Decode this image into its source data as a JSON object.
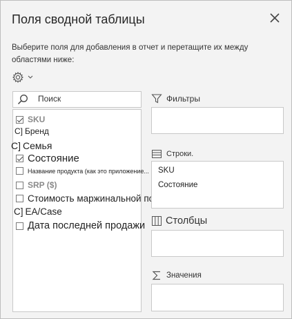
{
  "panel": {
    "title": "Поля сводной таблицы",
    "instruction": "Выберите поля для добавления в отчет и перетащите их между областями ниже:"
  },
  "icons": {
    "close": "close-icon",
    "settings": "gear-icon",
    "search": "search-icon",
    "filter": "filter-icon",
    "rows": "rows-icon",
    "columns": "columns-icon",
    "values": "sigma-icon"
  },
  "search": {
    "placeholder": "Поиск"
  },
  "fields": [
    {
      "label": "SKU",
      "checked": true,
      "style": "bold-muted",
      "prefix": ""
    },
    {
      "label": "Бренд",
      "checked": false,
      "style": "small",
      "prefix": "C]"
    },
    {
      "label": "Семья",
      "checked": false,
      "style": "medium",
      "prefix": "C]"
    },
    {
      "label": "Состояние",
      "checked": true,
      "style": "large",
      "prefix": ""
    },
    {
      "label": "Название продукта (как это приложение...",
      "checked": false,
      "style": "tiny",
      "prefix": ""
    },
    {
      "label": "SRP ($)",
      "checked": false,
      "style": "bold-muted",
      "prefix": ""
    },
    {
      "label": "Стоимость маржинальной позиции",
      "checked": false,
      "style": "medium",
      "prefix": ""
    },
    {
      "label": "EA/Case",
      "checked": false,
      "style": "medium",
      "prefix": "C]"
    },
    {
      "label": "Дата последней продажи",
      "checked": false,
      "style": "large",
      "prefix": ""
    }
  ],
  "areas": {
    "filters": {
      "label": "Фильтры",
      "items": []
    },
    "rows": {
      "label": "Строки.",
      "items": [
        "SKU",
        "Состояние"
      ]
    },
    "columns": {
      "label": "Столбцы",
      "items": []
    },
    "values": {
      "label": "Значения",
      "items": []
    }
  }
}
